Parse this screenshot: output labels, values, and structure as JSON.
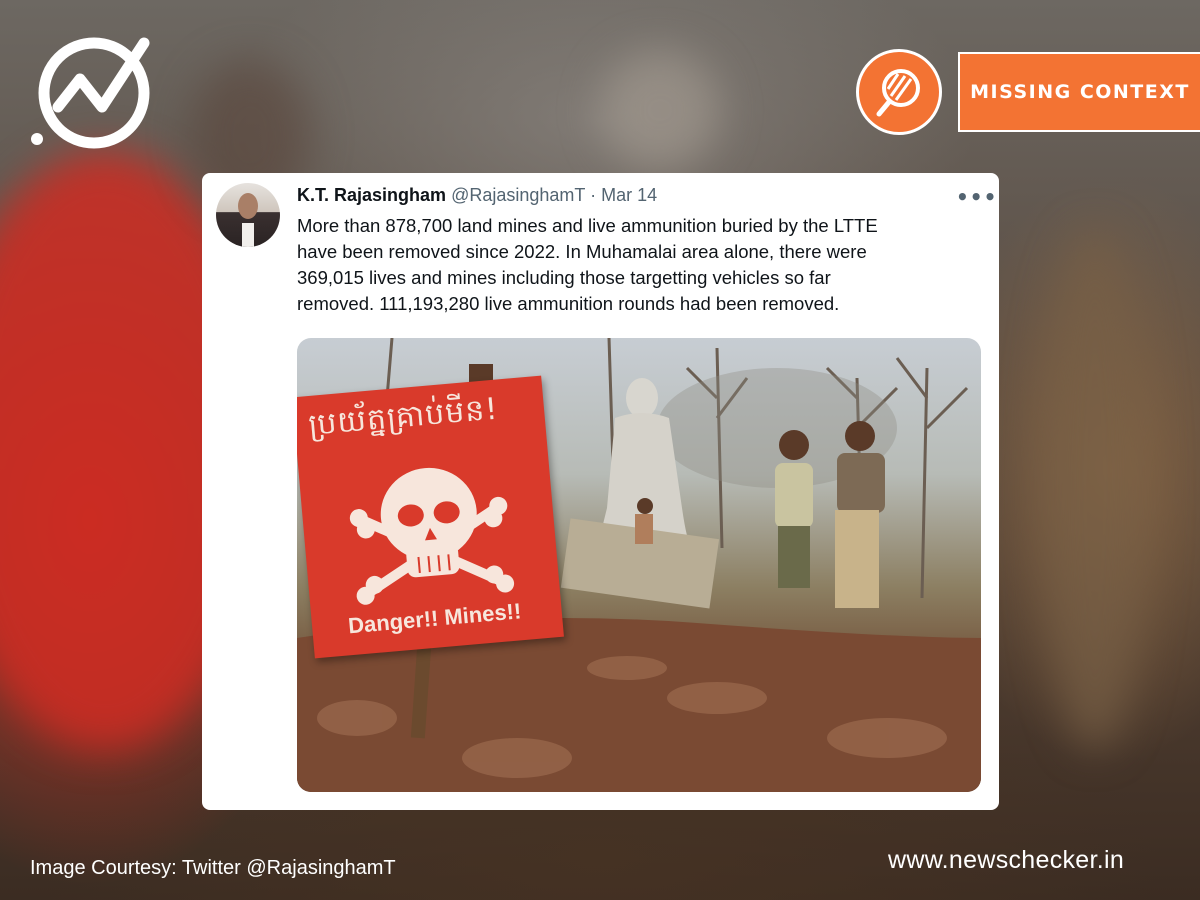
{
  "verdict": {
    "label": "MISSING CONTEXT",
    "icon": "magnifier-stripes-icon",
    "color": "#f37333"
  },
  "brand": {
    "logo": "newschecker-check-logo"
  },
  "tweet": {
    "author_name": "K.T. Rajasingham",
    "handle": "@RajasinghamT",
    "separator": "·",
    "date": "Mar 14",
    "more_label": "•••",
    "text": "More than 878,700 land mines and live ammunition buried  by the LTTE\nhave been removed since 2022. In Muhamalai  area alone, there were\n369,015 lives and mines  including those targetting vehicles so far\nremoved. 111,193,280 live ammunition rounds had been removed.",
    "photo": {
      "sign_khmer": "ប្រយ័ត្នគ្រាប់មីន!",
      "sign_text": "Danger!! Mines!!"
    }
  },
  "footer": {
    "credit": "Image Courtesy: Twitter @RajasinghamT",
    "site": "www.newschecker.in"
  }
}
